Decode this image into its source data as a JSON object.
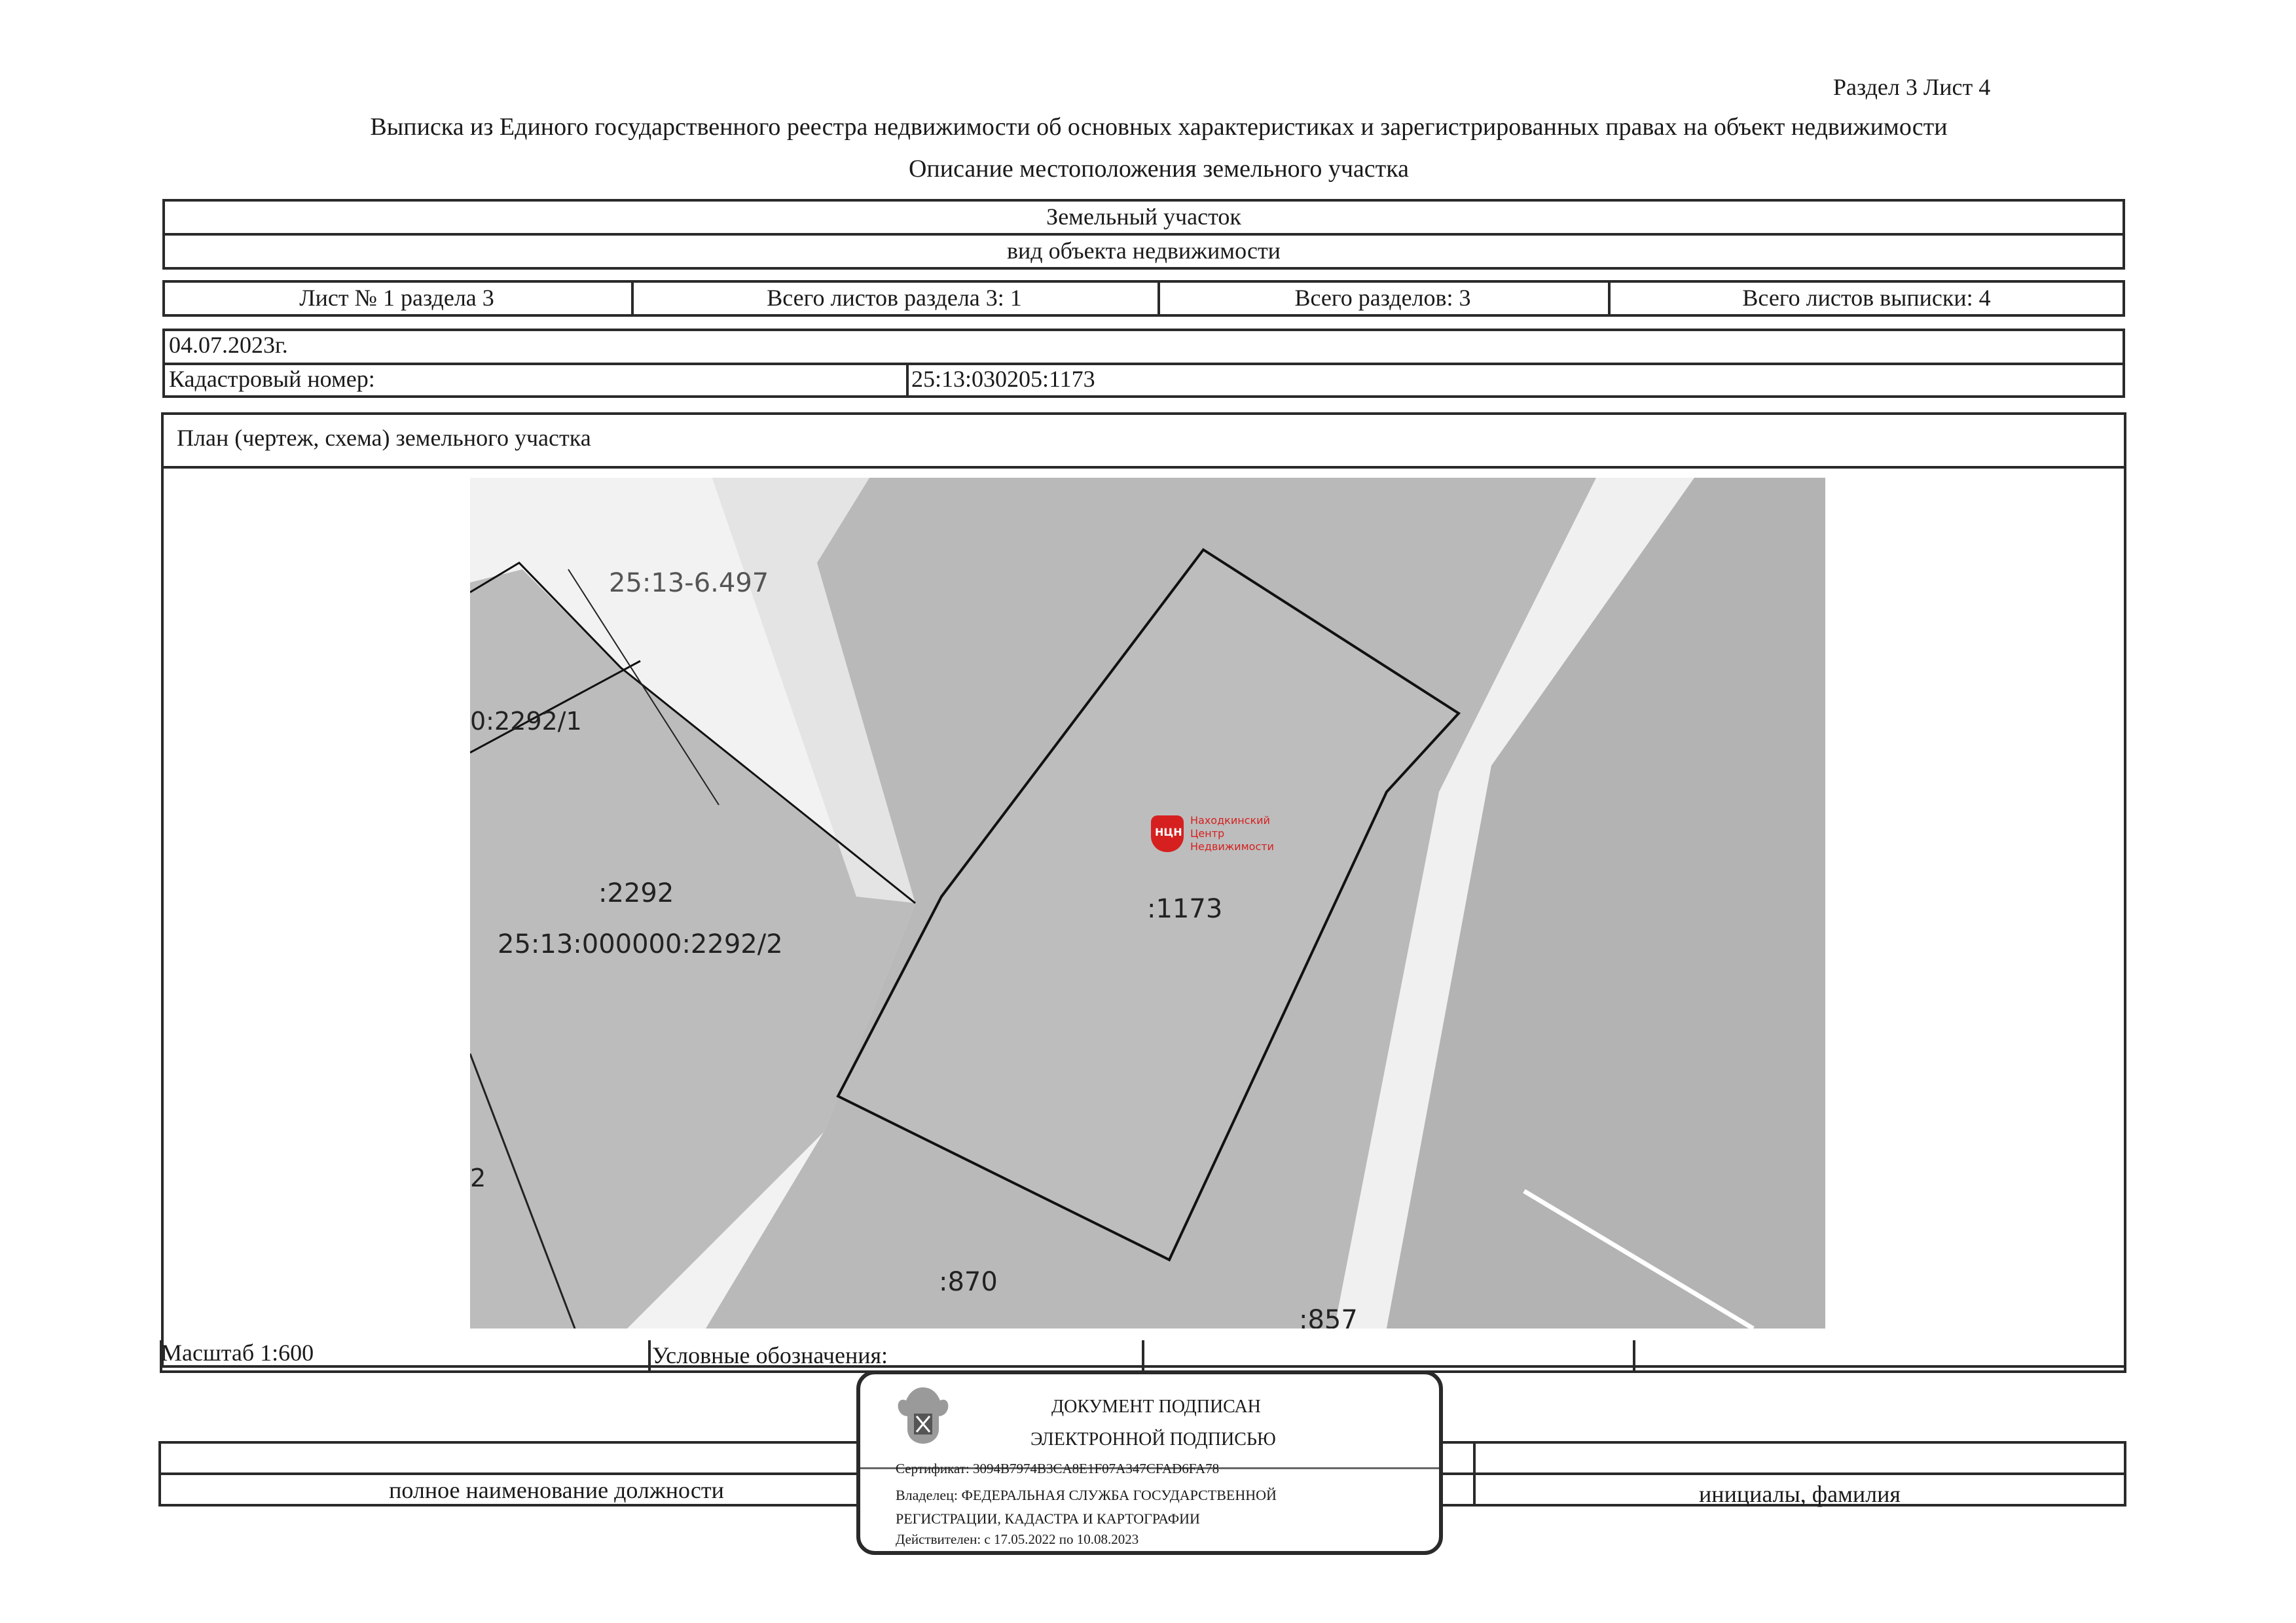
{
  "header": {
    "section_sheet": "Раздел 3    Лист 4",
    "title": "Выписка из Единого государственного реестра недвижимости об основных характеристиках и зарегистрированных правах на объект недвижимости",
    "subtitle": "Описание местоположения земельного участка"
  },
  "object": {
    "type_value": "Земельный участок",
    "type_caption": "вид объекта недвижимости"
  },
  "sheets": {
    "sheet_no": "Лист № 1 раздела 3",
    "sheets_in_section": "Всего листов раздела 3: 1",
    "total_sections": "Всего разделов: 3",
    "total_sheets": "Всего листов выписки: 4"
  },
  "record": {
    "date": "04.07.2023г.",
    "cadastral_label": "Кадастровый номер:",
    "cadastral_value": "25:13:030205:1173"
  },
  "plan": {
    "title": "План (чертеж, схема) земельного участка",
    "labels": {
      "zone": "25:13-6.497",
      "parcel_2292_1": "0:2292/1",
      "parcel_2292": ":2292",
      "parcel_2292_2": "25:13:000000:2292/2",
      "parcel_1173": ":1173",
      "parcel_870": ":870",
      "parcel_857": ":857",
      "edge_2": "2"
    },
    "watermark": {
      "line1": "Находкинский",
      "line2": "Центр",
      "line3": "Недвижимости",
      "badge": "НЦН"
    }
  },
  "footer": {
    "scale": "Масштаб 1:600",
    "legend": "Условные обозначения:",
    "position_caption": "полное наименование должности",
    "initials_caption": "инициалы, фамилия"
  },
  "stamp": {
    "line1": "ДОКУМЕНТ ПОДПИСАН",
    "line2": "ЭЛЕКТРОННОЙ ПОДПИСЬЮ",
    "certificate": "Сертификат: 3094B7974B3CA8E1F07A347CFAD6FA78",
    "owner_line1": "Владелец: ФЕДЕРАЛЬНАЯ СЛУЖБА ГОСУДАРСТВЕННОЙ",
    "owner_line2": "РЕГИСТРАЦИИ, КАДАСТРА И КАРТОГРАФИИ",
    "validity": "Действителен: с 17.05.2022 по 10.08.2023"
  },
  "colors": {
    "map_fill": "#b9b9b9",
    "road_fill": "#f2f2f2",
    "watermark_red": "#d62020"
  }
}
